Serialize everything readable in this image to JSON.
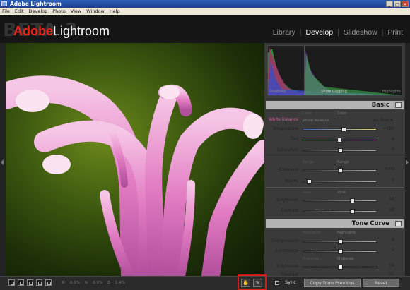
{
  "window": {
    "title": "Adobe Lightroom",
    "controls": [
      "_",
      "□",
      "✕"
    ]
  },
  "menu": [
    "File",
    "Edit",
    "Develop",
    "Photo",
    "View",
    "Window",
    "Help"
  ],
  "header": {
    "beta_watermark": "BETA 3",
    "logo_adobe": "Adobe",
    "logo_product": "Lightroom"
  },
  "modules": [
    {
      "label": "Library",
      "active": false
    },
    {
      "label": "Develop",
      "active": true
    },
    {
      "label": "Slideshow",
      "active": false
    },
    {
      "label": "Print",
      "active": false
    }
  ],
  "histogram": {
    "labels": [
      "Shadows",
      "Show Clipping",
      "Highlights"
    ]
  },
  "basic": {
    "title": "Basic",
    "wb_label": "White Balance",
    "color_label": "Color",
    "color_label2": "Color",
    "wb_sub": "White Balance",
    "wb_value": "As Shot ▾",
    "temperature": {
      "label": "Temperature",
      "value": "4450",
      "level": 0.55
    },
    "tint": {
      "label": "Tint",
      "value": "-6",
      "level": 0.49
    },
    "saturation": {
      "label": "Saturation",
      "value": "0",
      "level": 0.5
    },
    "range_label": "Range",
    "range_label2": "Range",
    "exposure": {
      "label": "Exposure",
      "value": "0.00",
      "level": 0.5
    },
    "blacks": {
      "label": "Blacks",
      "value": "5",
      "level": 0.05
    },
    "tone_label": "Tone",
    "tone_label2": "Tone",
    "brightness": {
      "label": "Brightness",
      "value": "50",
      "level": 0.67
    },
    "contrast": {
      "label": "Contrast",
      "value": "50",
      "level": 0.67
    },
    "contrast_sub": "Contrast"
  },
  "tone_curve": {
    "title": "Tone Curve",
    "highlights_label": "Highlights",
    "highlights_label2": "Highlights",
    "compression": {
      "label": "Compression",
      "value": "0",
      "level": 0.5
    },
    "luminance": {
      "label": "Luminance",
      "value": "0",
      "level": 0.5
    },
    "luminance_sub": "Luminance",
    "midtones_label": "Midtones",
    "midtones_label2": "Midtones",
    "brightness": {
      "label": "Brightness",
      "value": "50",
      "level": 0.5
    },
    "contrast_partial": {
      "label": "Contrast",
      "value": "50"
    }
  },
  "toolbar": {
    "rgb": [
      "R",
      "8.5%",
      "G",
      "8.9%",
      "B",
      "1.4%"
    ],
    "sync_label": "Sync",
    "copy_label": "Copy from Previous",
    "reset_label": "Reset"
  },
  "colors": {
    "accent_pink": "#d45a98",
    "highlight_box": "#d41b1b",
    "logo_red": "#e8231b"
  }
}
